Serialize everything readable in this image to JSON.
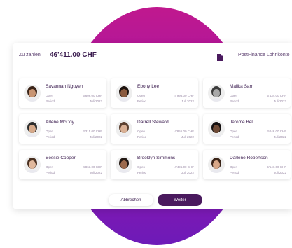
{
  "header": {
    "amount_label": "Zu zahlen",
    "amount_value": "46'411.00 CHF",
    "account_name": "PostFinance Lohnkonto"
  },
  "cards": [
    {
      "name": "Savannah Nguyen",
      "status": "Open",
      "amount": "5'606.00 CHF",
      "period_label": "Period",
      "period": "Juli 2022",
      "skin": "#c89472",
      "hair": "#3a2418"
    },
    {
      "name": "Ebony Lee",
      "status": "Open",
      "amount": "4'998.00 CHF",
      "period_label": "Period",
      "period": "Juli 2022",
      "skin": "#8a5a3e",
      "hair": "#1e140f"
    },
    {
      "name": "Malika Sarr",
      "status": "Open",
      "amount": "5'434.00 CHF",
      "period_label": "Period",
      "period": "Juli 2022",
      "skin": "#a8a8a8",
      "hair": "#3c3c3c"
    },
    {
      "name": "Arlene McCoy",
      "status": "Open",
      "amount": "5315.00 CHF",
      "period_label": "Period",
      "period": "Juli 2022",
      "skin": "#d6a98a",
      "hair": "#2c2c2c"
    },
    {
      "name": "Darrell Steward",
      "status": "Open",
      "amount": "4'856.00 CHF",
      "period_label": "Period",
      "period": "Juli 2022",
      "skin": "#d9b095",
      "hair": "#5b4030"
    },
    {
      "name": "Jerome Bell",
      "status": "Open",
      "amount": "5246.00 CHF",
      "period_label": "Period",
      "period": "Juli 2022",
      "skin": "#6e4a36",
      "hair": "#141010"
    },
    {
      "name": "Bessie Cooper",
      "status": "Open",
      "amount": "4'863.00 CHF",
      "period_label": "Period",
      "period": "Juli 2022",
      "skin": "#e0b89c",
      "hair": "#4a3020"
    },
    {
      "name": "Brooklyn Simmons",
      "status": "Open",
      "amount": "4'496.00 CHF",
      "period_label": "Period",
      "period": "Juli 2022",
      "skin": "#9c6a4c",
      "hair": "#221812"
    },
    {
      "name": "Darlene Robertson",
      "status": "Open",
      "amount": "5'547.00 CHF",
      "period_label": "Period",
      "period": "Juli 2022",
      "skin": "#d8a888",
      "hair": "#3a2418"
    }
  ],
  "footer": {
    "cancel_label": "Abbrechen",
    "next_label": "Weiter"
  },
  "colors": {
    "accent": "#4a1a5e",
    "blob_top": "#c0188e",
    "blob_bottom": "#6d1ab8"
  }
}
